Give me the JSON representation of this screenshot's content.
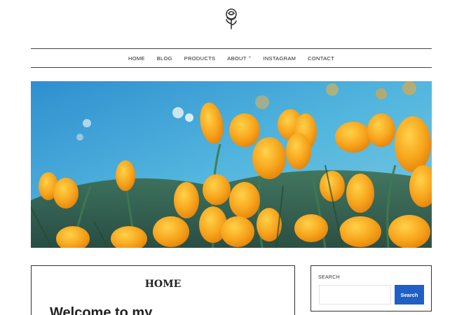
{
  "site": {
    "logo_icon": "rose-icon"
  },
  "nav": {
    "items": [
      {
        "label": "HOME"
      },
      {
        "label": "BLOG"
      },
      {
        "label": "PRODUCTS"
      },
      {
        "label": "ABOUT",
        "has_dropdown": true
      },
      {
        "label": "INSTAGRAM"
      },
      {
        "label": "CONTACT"
      }
    ]
  },
  "hero": {
    "image_subject": "field of orange poppies under blue sky"
  },
  "main": {
    "title": "HOME",
    "heading": "Welcome to my"
  },
  "sidebar": {
    "search": {
      "title": "SEARCH",
      "input_value": "",
      "placeholder": "",
      "button_label": "Search"
    }
  },
  "colors": {
    "accent": "#1f5fc6",
    "border": "#333333",
    "flower": "#f5a21b",
    "sky": "#3aa6d6"
  }
}
